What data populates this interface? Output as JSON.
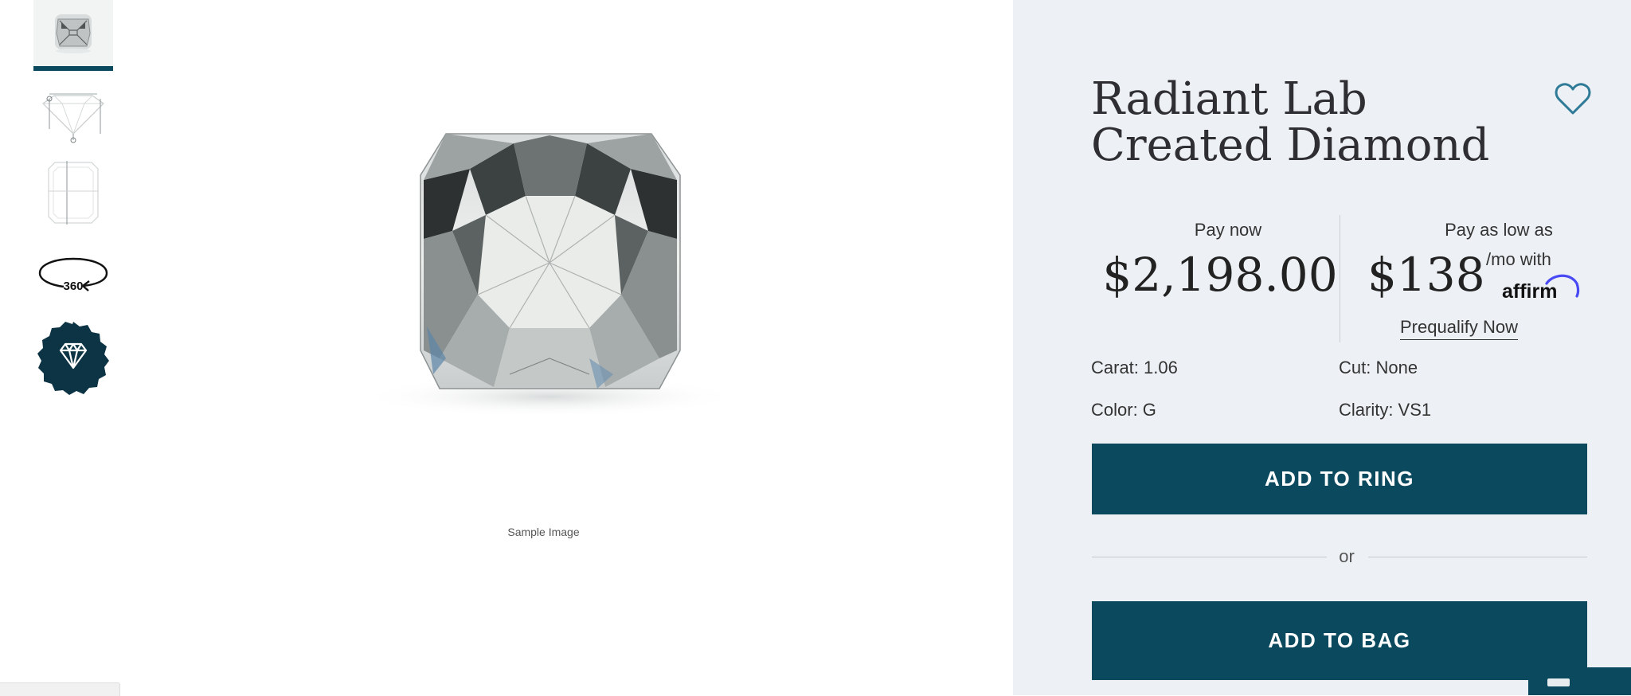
{
  "thumbnails": {
    "items": [
      {
        "name": "diamond-photo-thumb"
      },
      {
        "name": "side-profile-diagram-thumb"
      },
      {
        "name": "top-outline-diagram-thumb"
      },
      {
        "name": "rotate-360-thumb",
        "label": "360"
      },
      {
        "name": "diamond-badge-thumb"
      }
    ],
    "active_index": 0,
    "accent_color": "#0b4a5e"
  },
  "main_image": {
    "caption": "Sample Image"
  },
  "product": {
    "title": "Radiant Lab Created Diamond",
    "favorite_icon": "heart-outline-icon"
  },
  "pricing": {
    "pay_now_label": "Pay now",
    "pay_now_price": "$2,198.00",
    "pay_low_label": "Pay as low as",
    "monthly_price": "$138",
    "monthly_suffix": "/mo with",
    "affirm_logo": "affirm",
    "prequalify_label": "Prequalify Now"
  },
  "specs": {
    "carat": "Carat: 1.06",
    "cut": "Cut: None",
    "color": "Color: G",
    "clarity": "Clarity: VS1"
  },
  "actions": {
    "add_to_ring": "ADD TO RING",
    "or_text": "or",
    "add_to_bag": "ADD TO BAG"
  },
  "colors": {
    "panel_bg": "#edf1f5",
    "button_bg": "#0b4a5e",
    "button_text": "#ffffff",
    "heart": "#2f7a96",
    "affirm_arc": "#4a4af4"
  }
}
